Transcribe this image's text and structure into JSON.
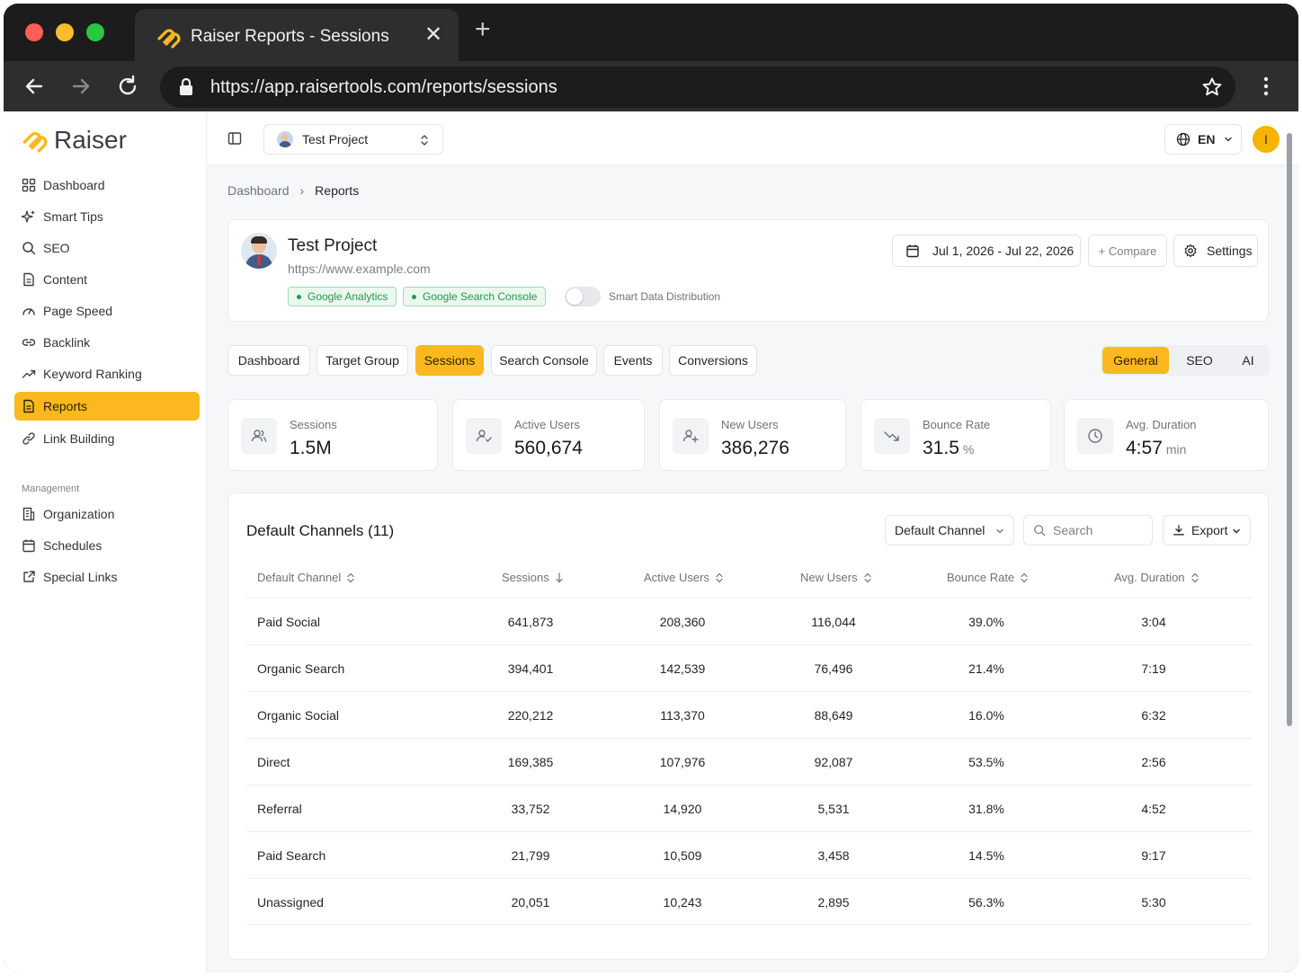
{
  "browser": {
    "tab_title": "Raiser Reports - Sessions",
    "url": "https://app.raisertools.com/reports/sessions",
    "traffic_light_colors": [
      "#ff5f57",
      "#febc2e",
      "#28c840"
    ]
  },
  "brand": {
    "name": "Raiser",
    "accent": "#fbb91f"
  },
  "sidebar": {
    "items": [
      {
        "label": "Dashboard",
        "icon": "grid-icon"
      },
      {
        "label": "Smart Tips",
        "icon": "sparkle-icon"
      },
      {
        "label": "SEO",
        "icon": "search-icon"
      },
      {
        "label": "Content",
        "icon": "document-icon"
      },
      {
        "label": "Page Speed",
        "icon": "gauge-icon"
      },
      {
        "label": "Backlink",
        "icon": "link-icon"
      },
      {
        "label": "Keyword Ranking",
        "icon": "trend-up-icon"
      },
      {
        "label": "Reports",
        "icon": "report-icon",
        "active": true
      },
      {
        "label": "Link Building",
        "icon": "chain-icon"
      }
    ],
    "management_label": "Management",
    "management_items": [
      {
        "label": "Organization",
        "icon": "building-icon"
      },
      {
        "label": "Schedules",
        "icon": "calendar-icon"
      },
      {
        "label": "Special Links",
        "icon": "external-link-icon"
      }
    ]
  },
  "topbar": {
    "project": "Test Project",
    "language": "EN",
    "user_initial": "I"
  },
  "breadcrumb": {
    "root": "Dashboard",
    "current": "Reports"
  },
  "project_card": {
    "name": "Test Project",
    "url": "https://www.example.com",
    "badges": [
      "Google Analytics",
      "Google Search Console"
    ],
    "smart_toggle_label": "Smart Data Distribution",
    "smart_toggle_on": false,
    "date_range": "Jul 1, 2026 - Jul 22, 2026",
    "compare_label": "+ Compare",
    "settings_label": "Settings"
  },
  "report_tabs": [
    "Dashboard",
    "Target Group",
    "Sessions",
    "Search Console",
    "Events",
    "Conversions"
  ],
  "active_report_tab": "Sessions",
  "view_modes": [
    "General",
    "SEO",
    "AI"
  ],
  "active_view_mode": "General",
  "metrics": [
    {
      "label": "Sessions",
      "value": "1.5M",
      "unit": "",
      "icon": "users-icon"
    },
    {
      "label": "Active Users",
      "value": "560,674",
      "unit": "",
      "icon": "user-active-icon"
    },
    {
      "label": "New Users",
      "value": "386,276",
      "unit": "",
      "icon": "user-plus-icon"
    },
    {
      "label": "Bounce Rate",
      "value": "31.5",
      "unit": "%",
      "icon": "trend-down-icon"
    },
    {
      "label": "Avg. Duration",
      "value": "4:57",
      "unit": "min",
      "icon": "clock-icon"
    }
  ],
  "table": {
    "title": "Default Channels (11)",
    "filter_label": "Default Channel",
    "search_placeholder": "Search",
    "export_label": "Export",
    "columns": [
      "Default Channel",
      "Sessions",
      "Active Users",
      "New Users",
      "Bounce Rate",
      "Avg. Duration"
    ],
    "rows": [
      [
        "Paid Social",
        "641,873",
        "208,360",
        "116,044",
        "39.0%",
        "3:04"
      ],
      [
        "Organic Search",
        "394,401",
        "142,539",
        "76,496",
        "21.4%",
        "7:19"
      ],
      [
        "Organic Social",
        "220,212",
        "113,370",
        "88,649",
        "16.0%",
        "6:32"
      ],
      [
        "Direct",
        "169,385",
        "107,976",
        "92,087",
        "53.5%",
        "2:56"
      ],
      [
        "Referral",
        "33,752",
        "14,920",
        "5,531",
        "31.8%",
        "4:52"
      ],
      [
        "Paid Search",
        "21,799",
        "10,509",
        "3,458",
        "14.5%",
        "9:17"
      ],
      [
        "Unassigned",
        "20,051",
        "10,243",
        "2,895",
        "56.3%",
        "5:30"
      ]
    ]
  }
}
